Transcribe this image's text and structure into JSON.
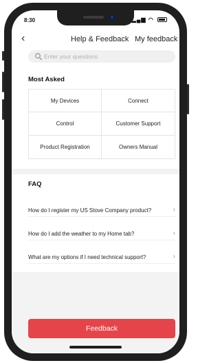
{
  "status_bar": {
    "time": "8:30",
    "indicators": "signal-wifi-battery"
  },
  "header": {
    "back_icon": "chevron-left-icon",
    "title": "Help & Feedback",
    "my_feedback_label": "My feedback"
  },
  "search": {
    "icon": "search-icon",
    "placeholder": "Enter your questions"
  },
  "most_asked": {
    "title": "Most Asked",
    "items": [
      {
        "label": "My Devices"
      },
      {
        "label": "Connect"
      },
      {
        "label": "Control"
      },
      {
        "label": "Customer Support"
      },
      {
        "label": "Product Registration"
      },
      {
        "label": "Owners Manual"
      }
    ]
  },
  "faq": {
    "title": "FAQ",
    "items": [
      {
        "question": "How do I register my US Stove Company product?"
      },
      {
        "question": "How do I add the weather to my Home tab?"
      },
      {
        "question": "What are my options if I need technical support?"
      }
    ]
  },
  "feedback_button": {
    "label": "Feedback",
    "color": "#e5454a"
  }
}
